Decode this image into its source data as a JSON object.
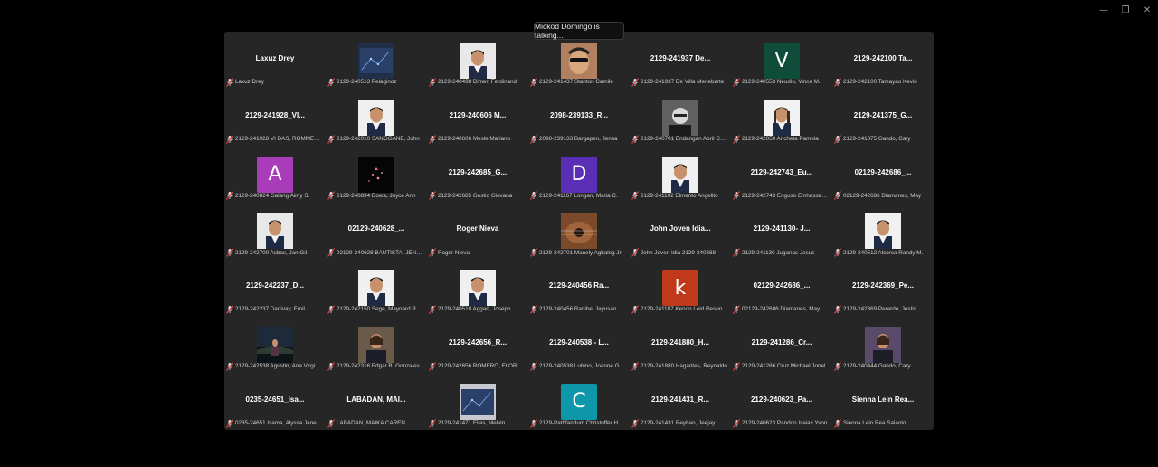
{
  "window": {
    "minimize": "—",
    "restore": "❐",
    "close": "✕"
  },
  "speaking_indicator": "Mickod Domingo is talking...",
  "colors": {
    "gallery_bg": "#262626",
    "muted_mic": "#e04040"
  },
  "participants": [
    {
      "display": "Laxuz Drey",
      "label": "Laxuz Drey",
      "kind": "text"
    },
    {
      "display": "",
      "label": "2129-240513 Pelaginoz",
      "kind": "photo",
      "photo": "network-photo",
      "tone": "#203048"
    },
    {
      "display": "",
      "label": "2129-240498 Dimer, Ferdinand",
      "kind": "photo",
      "photo": "portrait-photo",
      "tone": "#e8e8e8"
    },
    {
      "display": "",
      "label": "2129-241437 Stanton Camile",
      "kind": "photo",
      "photo": "sunglasses-photo",
      "tone": "#b08060"
    },
    {
      "display": "2129-241937 De...",
      "label": "2129-241937 De Villa Menebarte",
      "kind": "text"
    },
    {
      "display": "",
      "label": "2129-240553 Neudio, Vince M.",
      "kind": "avatar",
      "letter": "V",
      "color": "#0f4d3a"
    },
    {
      "display": "2129-242100 Ta...",
      "label": "2129-242100 Tamayao Kevin",
      "kind": "text"
    },
    {
      "display": "2129-241928_VI...",
      "label": "2129-241928 VI DAS, ROMMEL G.",
      "kind": "text"
    },
    {
      "display": "",
      "label": "2129-242010 SANGGANE, John",
      "kind": "photo",
      "photo": "portrait-photo",
      "tone": "#f0f0f0"
    },
    {
      "display": "2129-240606 M...",
      "label": "2129-240606 Mesle Mariano",
      "kind": "text"
    },
    {
      "display": "2098-239133_R...",
      "label": "2098-239133 Bargapen, Jensa",
      "kind": "text"
    },
    {
      "display": "",
      "label": "2129-240701 Endangan Abril Cruz",
      "kind": "photo",
      "photo": "bw-photo",
      "tone": "#606060"
    },
    {
      "display": "",
      "label": "2129-242050 Ancheta Pamela",
      "kind": "photo",
      "photo": "woman-photo",
      "tone": "#f2f2f2"
    },
    {
      "display": "2129-241375_G...",
      "label": "2129-241375 Gando, Cary",
      "kind": "text"
    },
    {
      "display": "",
      "label": "2129-240824 Galang Aimy S.",
      "kind": "avatar",
      "letter": "A",
      "color": "#a93cb8"
    },
    {
      "display": "",
      "label": "2129-240894 Dowa, Joyce Ann",
      "kind": "photo",
      "photo": "hello-kitty-photo",
      "tone": "#050505"
    },
    {
      "display": "2129-242685_G...",
      "label": "2129-242685 Gestio Giovana",
      "kind": "text"
    },
    {
      "display": "",
      "label": "2129-241167 Longan, Maria C.",
      "kind": "avatar",
      "letter": "D",
      "color": "#5b2fb5"
    },
    {
      "display": "",
      "label": "2129-241102 Elmento Angelito",
      "kind": "photo",
      "photo": "portrait-photo",
      "tone": "#f0f0f0"
    },
    {
      "display": "2129-242743_Eu...",
      "label": "2129-242743 Enguso Emhassador",
      "kind": "text"
    },
    {
      "display": "02129-242686_...",
      "label": "02129-242686 Diamanes, May",
      "kind": "text"
    },
    {
      "display": "",
      "label": "2129-242700 Asbas, Jan Gil",
      "kind": "photo",
      "photo": "portrait-photo",
      "tone": "#e8e8e8"
    },
    {
      "display": "02129-240628_...",
      "label": "02129-240628 BAUTISTA, JENINA",
      "kind": "text"
    },
    {
      "display": "Roger Nieva",
      "label": "Roger Nieva",
      "kind": "text"
    },
    {
      "display": "",
      "label": "2129-242701 Manely Agbalog Jr.",
      "kind": "photo",
      "photo": "guitar-photo",
      "tone": "#7a4a2a"
    },
    {
      "display": "John Joven Idia...",
      "label": "John Joven Idia 2129-240388",
      "kind": "text"
    },
    {
      "display": "2129-241130- J...",
      "label": "2129-241130 Juganas Jesus",
      "kind": "text"
    },
    {
      "display": "",
      "label": "2129-240512 Alcorca Randy M.",
      "kind": "photo",
      "photo": "portrait-photo",
      "tone": "#f0f0f0"
    },
    {
      "display": "2129-242237_D...",
      "label": "2129-242237 Dadivay, Emil",
      "kind": "text"
    },
    {
      "display": "",
      "label": "2129-242150 Sege, Maynard R.",
      "kind": "photo",
      "photo": "portrait-photo",
      "tone": "#f0f0f0"
    },
    {
      "display": "",
      "label": "2129-240510 Aggari, Joseph",
      "kind": "photo",
      "photo": "portrait-photo",
      "tone": "#f0f0f0"
    },
    {
      "display": "2129-240456 Ra...",
      "label": "2129-240456 Ranibel Jayusan",
      "kind": "text"
    },
    {
      "display": "",
      "label": "2129-241187 Kenon Leid Reson",
      "kind": "avatar",
      "letter": "k",
      "color": "#c0391b"
    },
    {
      "display": "02129-242686_...",
      "label": "02129-242686 Diamanes, May",
      "kind": "text"
    },
    {
      "display": "2129-242369_Pe...",
      "label": "2129-242369 Perardo, Jestis",
      "kind": "text"
    },
    {
      "display": "",
      "label": "2129-242538 Agustin, Ana Virginia",
      "kind": "photo",
      "photo": "night-photo",
      "tone": "#1c2a3a"
    },
    {
      "display": "",
      "label": "2129-242316 Edgar B. Gonzales",
      "kind": "photo",
      "photo": "man-photo",
      "tone": "#6a5a4a"
    },
    {
      "display": "2129-242656_R...",
      "label": "2129-242656 ROMERO, FLORENTINA",
      "kind": "text"
    },
    {
      "display": "2129-240538 - L...",
      "label": "2129-240538 Lubino, Joanne G.",
      "kind": "text"
    },
    {
      "display": "2129-241880_H...",
      "label": "2129-241880 Hagarites, Reynaldo",
      "kind": "text"
    },
    {
      "display": "2129-241286_Cr...",
      "label": "2129-241286 Cruz Michael Jonel",
      "kind": "text"
    },
    {
      "display": "",
      "label": "2129-240444 Gando, Cary",
      "kind": "photo",
      "photo": "man-photo",
      "tone": "#5a4a6a"
    },
    {
      "display": "0235-24651_Isa...",
      "label": "0235-24651 Isama, Alyssa Jane M.",
      "kind": "text"
    },
    {
      "display": "LABADAN, MAI...",
      "label": "LABADAN, MAIKA CAREN",
      "kind": "text"
    },
    {
      "display": "",
      "label": "2129-241471 Elias, Melvin",
      "kind": "photo",
      "photo": "screen-photo",
      "tone": "#c8c8d0"
    },
    {
      "display": "",
      "label": "2129-Pathfandum Christoffer Henry",
      "kind": "avatar",
      "letter": "C",
      "color": "#0e97a8"
    },
    {
      "display": "2129-241431_R...",
      "label": "2129-241431 Reyhan, Jeejay",
      "kind": "text"
    },
    {
      "display": "2129-240623_Pa...",
      "label": "2129-240623 Pandon Isaias Yvon",
      "kind": "text"
    },
    {
      "display": "Sienna Lein Rea...",
      "label": "Sienna Lein Rea Salaolo",
      "kind": "text"
    }
  ]
}
